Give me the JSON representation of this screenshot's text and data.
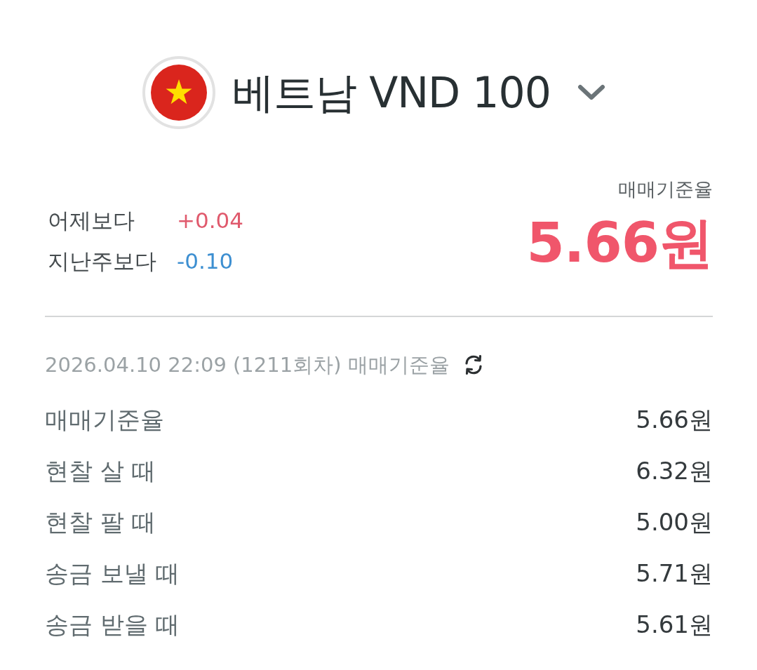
{
  "header": {
    "title": "베트남 VND 100"
  },
  "changes": [
    {
      "label": "어제보다",
      "value": "+0.04",
      "color": "#e05a6d"
    },
    {
      "label": "지난주보다",
      "value": "-0.10",
      "color": "#3d8fd1"
    }
  ],
  "base_rate": {
    "label": "매매기준율",
    "value": "5.66원"
  },
  "updated": "2026.04.10 22:09 (1211회차) 매매기준율",
  "rates": [
    {
      "label": "매매기준율",
      "value": "5.66원"
    },
    {
      "label": "현찰 살 때",
      "value": "6.32원"
    },
    {
      "label": "현찰 팔 때",
      "value": "5.00원"
    },
    {
      "label": "송금 보낼 때",
      "value": "5.71원"
    },
    {
      "label": "송금 받을 때",
      "value": "5.61원"
    }
  ]
}
